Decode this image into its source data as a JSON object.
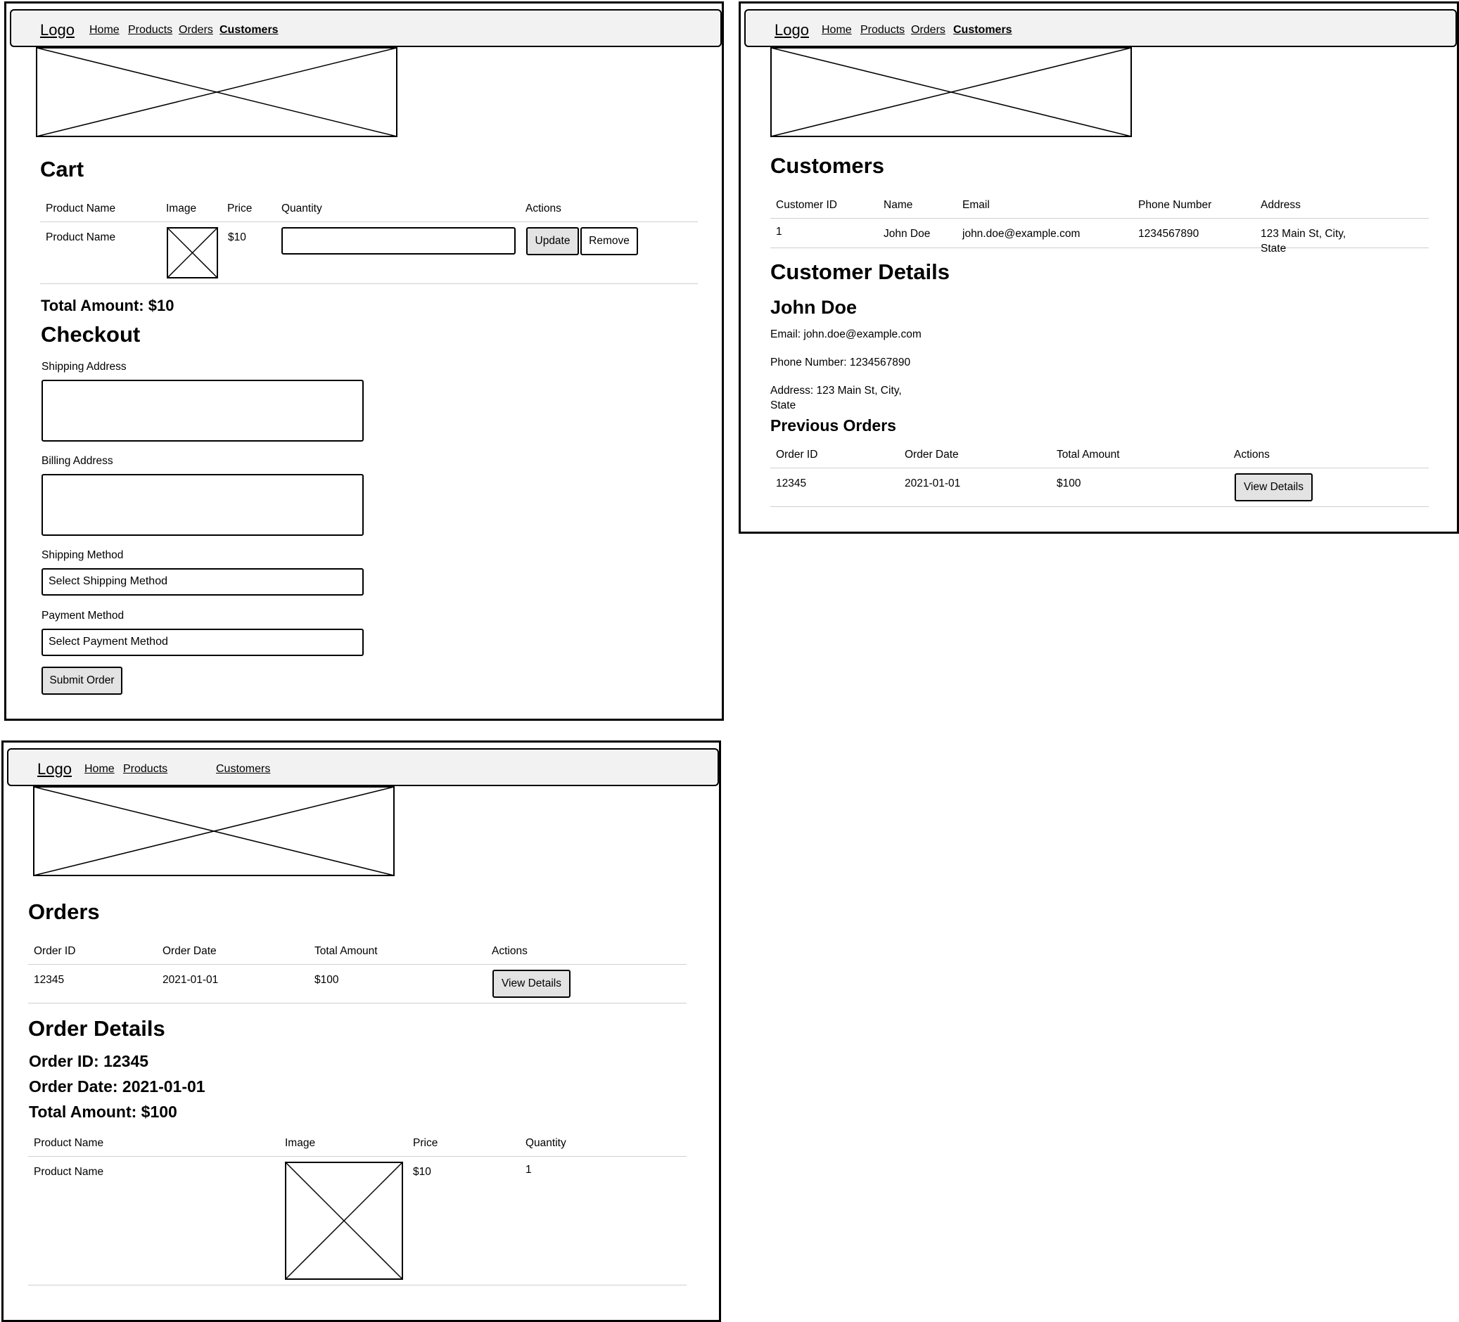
{
  "nav": {
    "logo": "Logo",
    "home": "Home",
    "products": "Products",
    "orders": "Orders",
    "customers": "Customers"
  },
  "cart": {
    "title": "Cart",
    "headers": [
      "Product Name",
      "Image",
      "Price",
      "Quantity",
      "Actions"
    ],
    "row": {
      "product_name": "Product Name",
      "price": "$10",
      "quantity": ""
    },
    "update_label": "Update",
    "remove_label": "Remove",
    "total": "Total Amount: $10"
  },
  "checkout": {
    "title": "Checkout",
    "shipping_address_label": "Shipping Address",
    "billing_address_label": "Billing Address",
    "shipping_method_label": "Shipping Method",
    "shipping_method_value": "Select Shipping Method",
    "payment_method_label": "Payment Method",
    "payment_method_value": "Select Payment Method",
    "submit_label": "Submit Order"
  },
  "customers": {
    "title": "Customers",
    "headers": [
      "Customer ID",
      "Name",
      "Email",
      "Phone Number",
      "Address"
    ],
    "row": {
      "id": "1",
      "name": "John Doe",
      "email": "john.doe@example.com",
      "phone": "1234567890",
      "address_line1": "123 Main St, City,",
      "address_line2": "State"
    }
  },
  "customer_details": {
    "title": "Customer Details",
    "name": "John Doe",
    "email": "Email: john.doe@example.com",
    "phone": "Phone Number: 1234567890",
    "address_line1": "Address: 123 Main St, City,",
    "address_line2": "State",
    "previous_orders_title": "Previous Orders",
    "orders_headers": [
      "Order ID",
      "Order Date",
      "Total Amount",
      "Actions"
    ],
    "order_row": {
      "id": "12345",
      "date": "2021-01-01",
      "total": "$100"
    },
    "view_details_label": "View Details"
  },
  "orders": {
    "title": "Orders",
    "headers": [
      "Order ID",
      "Order Date",
      "Total Amount",
      "Actions"
    ],
    "row": {
      "id": "12345",
      "date": "2021-01-01",
      "total": "$100"
    },
    "view_details_label": "View Details"
  },
  "order_details": {
    "title": "Order Details",
    "order_id": "Order ID: 12345",
    "order_date": "Order Date: 2021-01-01",
    "total_amount": "Total Amount: $100",
    "headers": [
      "Product Name",
      "Image",
      "Price",
      "Quantity"
    ],
    "row": {
      "product_name": "Product Name",
      "price": "$10",
      "quantity": "1"
    }
  }
}
